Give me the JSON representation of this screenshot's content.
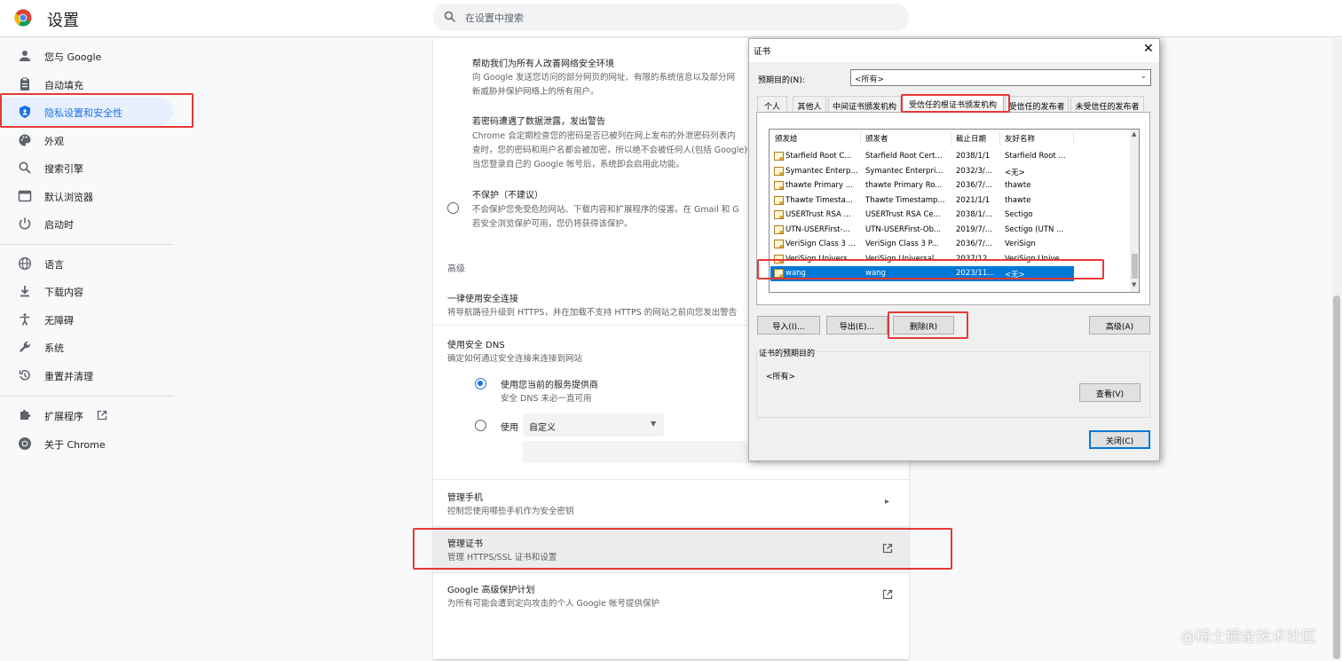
{
  "app": {
    "title": "设置"
  },
  "search": {
    "placeholder": "在设置中搜索"
  },
  "sidebar": {
    "items": [
      {
        "label": "您与 Google",
        "icon": "person-icon"
      },
      {
        "label": "自动填充",
        "icon": "clipboard-icon"
      },
      {
        "label": "隐私设置和安全性",
        "icon": "shield-icon",
        "active": true
      },
      {
        "label": "外观",
        "icon": "palette-icon"
      },
      {
        "label": "搜索引擎",
        "icon": "search-icon"
      },
      {
        "label": "默认浏览器",
        "icon": "browser-icon"
      },
      {
        "label": "启动时",
        "icon": "power-icon"
      },
      {
        "label": "语言",
        "icon": "globe-icon"
      },
      {
        "label": "下载内容",
        "icon": "download-icon"
      },
      {
        "label": "无障碍",
        "icon": "accessibility-icon"
      },
      {
        "label": "系统",
        "icon": "wrench-icon"
      },
      {
        "label": "重置并清理",
        "icon": "restore-icon"
      },
      {
        "label": "扩展程序",
        "icon": "puzzle-icon"
      },
      {
        "label": "关于 Chrome",
        "icon": "chrome-icon"
      }
    ]
  },
  "main": {
    "help_title": "帮助我们为所有人改善网络安全环境",
    "help_desc1": "向 Google 发送您访问的部分网页的网址、有限的系统信息以及部分网",
    "help_desc2": "新威胁并保护网络上的所有用户。",
    "leak_title": "若密码遭遇了数据泄露，发出警告",
    "leak_desc1": "Chrome 会定期检查您的密码是否已被列在网上发布的外泄密码列表内",
    "leak_desc2": "查时，您的密码和用户名都会被加密，所以绝不会被任何人(包括 Google)读取。",
    "leak_desc3": "当您登录自己的 Google 帐号后，系统即会启用此功能。",
    "noprotect_title": "不保护（不建议）",
    "noprotect_desc1": "不会保护您免受危险网站、下载内容和扩展程序的侵害。在 Gmail 和 G",
    "noprotect_desc2": "若安全浏览保护可用，您仍将获得该保护。",
    "advanced_header": "高级",
    "https_title": "一律使用安全连接",
    "https_desc": "将导航路径升级到 HTTPS，并在加载不支持 HTTPS 的网站之前向您发出警告",
    "dns_title": "使用安全 DNS",
    "dns_desc": "确定如何通过安全连接来连接到网站",
    "dns_opt1_title": "使用您当前的服务提供商",
    "dns_opt1_desc": "安全 DNS 未必一直可用",
    "dns_opt2_label": "使用",
    "dns_select_value": "自定义",
    "phone_title": "管理手机",
    "phone_desc": "控制您使用哪些手机作为安全密钥",
    "cert_title": "管理证书",
    "cert_desc": "管理 HTTPS/SSL 证书和设置",
    "gapp_title": "Google 高级保护计划",
    "gapp_desc": "为所有可能会遭到定向攻击的个人 Google 帐号提供保护"
  },
  "dialog": {
    "title": "证书",
    "close": "✕",
    "purpose_label": "预期目的(N):",
    "purpose_value": "<所有>",
    "tabs": [
      "个人",
      "其他人",
      "中间证书颁发机构",
      "受信任的根证书颁发机构",
      "受信任的发布者",
      "未受信任的发布者"
    ],
    "columns": [
      "颁发给",
      "颁发者",
      "截止日期",
      "友好名称"
    ],
    "rows": [
      {
        "issued_to": "Starfield Root C...",
        "issuer": "Starfield Root Cert...",
        "expires": "2038/1/1",
        "friendly": "Starfield Root ..."
      },
      {
        "issued_to": "Symantec Enterp...",
        "issuer": "Symantec Enterpri...",
        "expires": "2032/3/...",
        "friendly": "<无>"
      },
      {
        "issued_to": "thawte Primary ...",
        "issuer": "thawte Primary Ro...",
        "expires": "2036/7/...",
        "friendly": "thawte"
      },
      {
        "issued_to": "Thawte Timesta...",
        "issuer": "Thawte Timestamp...",
        "expires": "2021/1/1",
        "friendly": "thawte"
      },
      {
        "issued_to": "USERTrust RSA ...",
        "issuer": "USERTrust RSA Ce...",
        "expires": "2038/1/...",
        "friendly": "Sectigo"
      },
      {
        "issued_to": "UTN-USERFirst-...",
        "issuer": "UTN-USERFirst-Ob...",
        "expires": "2019/7/...",
        "friendly": "Sectigo (UTN ..."
      },
      {
        "issued_to": "VeriSign Class 3 ...",
        "issuer": "VeriSign Class 3 P...",
        "expires": "2036/7/...",
        "friendly": "VeriSign"
      },
      {
        "issued_to": "VeriSign Univers...",
        "issuer": "VeriSign Universal ...",
        "expires": "2037/12...",
        "friendly": "VeriSign Unive..."
      },
      {
        "issued_to": "wang",
        "issuer": "wang",
        "expires": "2023/11...",
        "friendly": "<无>",
        "selected": true
      }
    ],
    "btn_import": "导入(I)...",
    "btn_export": "导出(E)...",
    "btn_remove": "删除(R)",
    "btn_advanced": "高级(A)",
    "purpose_group_title": "证书的预期目的",
    "purpose_group_value": "<所有>",
    "btn_view": "查看(V)",
    "btn_close": "关闭(C)"
  },
  "watermark": "@稀土掘金技术社区",
  "colors": {
    "accent": "#1a73e8",
    "highlight": "#e53935",
    "selection": "#0078d7"
  }
}
